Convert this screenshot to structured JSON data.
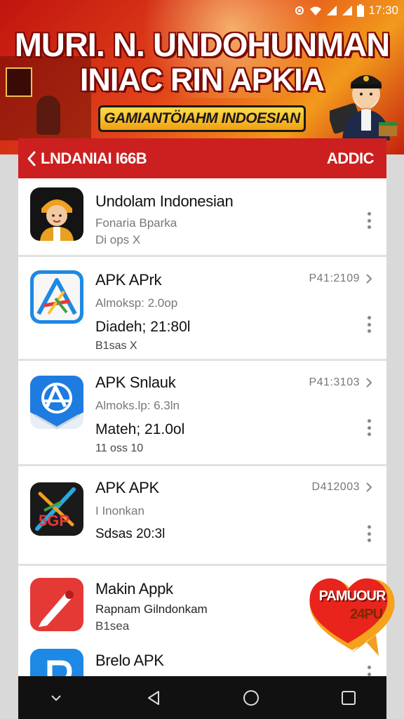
{
  "status_bar": {
    "time": "17:30"
  },
  "banner": {
    "title_line1": "MURI. N. UNDOHUNMAN",
    "title_line2": "INIAC RIN APKIA",
    "subtitle": "GAMIANTÖIAHM INDOESIAN"
  },
  "app_bar": {
    "title": "LNDANIAI I66B",
    "action": "ADDIC"
  },
  "apps": [
    {
      "name": "Undolam Indonesian",
      "line2": "Fonaria Bparka",
      "line3": "Di ops X",
      "date": ""
    },
    {
      "name": "APK APrk",
      "line2": "Almoksp: 2.0op",
      "line3": "Diadeh; 21:80l",
      "line4": "B1sas X",
      "date": "P41:2109"
    },
    {
      "name": "APK Snlauk",
      "line2": "Almoks.lp: 6.3ln",
      "line3": "Mateh; 21.0ol",
      "line4": "11 oss 10",
      "date": "P41:3103"
    },
    {
      "name": "APK APK",
      "line2": "I Inonkan",
      "line3": "Sdsas 20:3l",
      "date": "D412003",
      "icon_text": "5GP"
    },
    {
      "name": "Makin Appk",
      "line2": "Rapnam Gilndonkam",
      "line3": "B1sea",
      "date": ""
    },
    {
      "name": "Brelo APK",
      "date": ""
    }
  ],
  "badge": {
    "line1": "PAMUOUR",
    "line2": "24PU"
  },
  "colors": {
    "accent": "#cc1f1f",
    "banner": "#e2431a",
    "nav": "#111111"
  }
}
